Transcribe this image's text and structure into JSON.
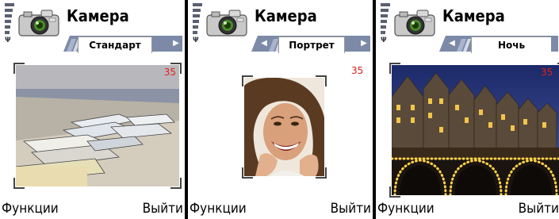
{
  "screens": [
    {
      "title": "Камера",
      "tab": "Стандарт",
      "counter": "35",
      "left_softkey": "Функции",
      "right_softkey": "Выйти",
      "scene": "boats-on-beach"
    },
    {
      "title": "Камера",
      "tab": "Портрет",
      "counter": "35",
      "left_softkey": "Функции",
      "right_softkey": "Выйти",
      "scene": "smiling-woman-portrait"
    },
    {
      "title": "Камера",
      "tab": "Ночь",
      "counter": "35",
      "left_softkey": "Функции",
      "right_softkey": "Выйти",
      "scene": "canal-houses-at-night"
    }
  ],
  "icons": {
    "signal": "signal-strength-icon",
    "antenna": "antenna-icon",
    "app": "camera-app-icon",
    "tab_prev": "tab-left-arrow-icon",
    "tab_next": "tab-right-arrow-icon"
  },
  "colors": {
    "counter": "#e0201c",
    "tab_bar": "#7c8aa8"
  }
}
